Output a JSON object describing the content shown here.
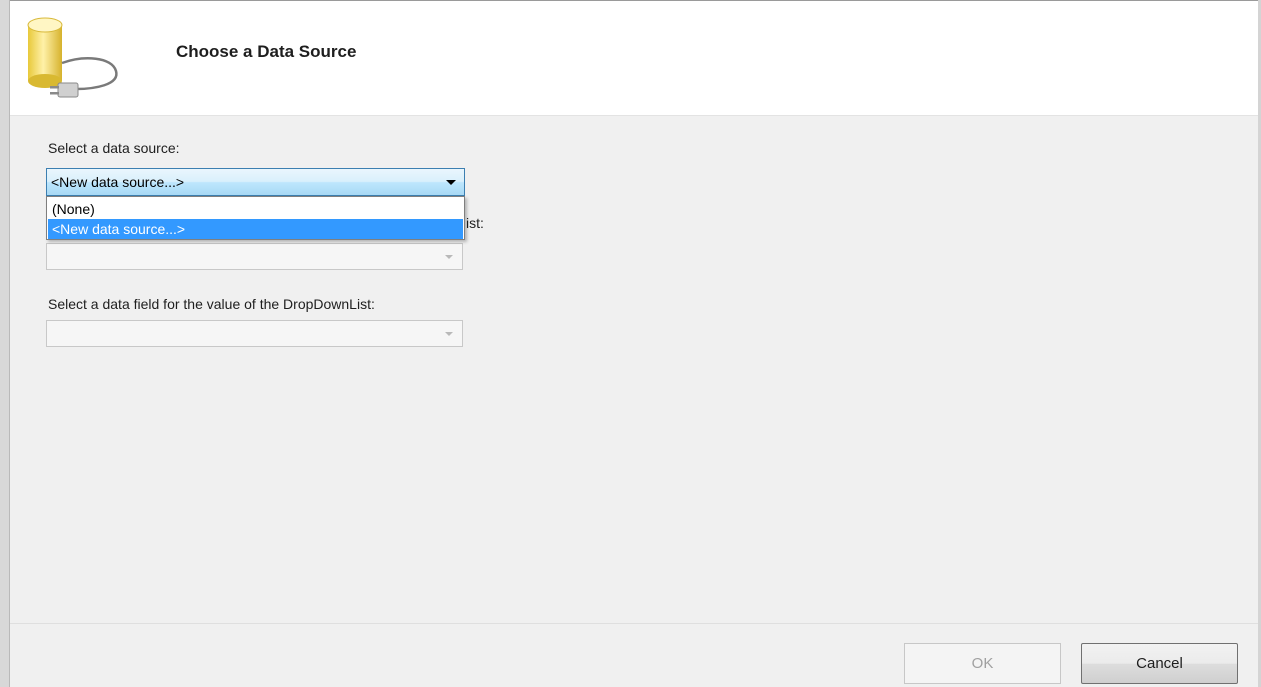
{
  "header": {
    "title": "Choose a Data Source",
    "icon": "database-plug-icon"
  },
  "data_source": {
    "label": "Select a data source:",
    "selected": "<New data source...>",
    "options": [
      "(None)",
      "<New data source...>"
    ],
    "hidden_label_suffix": "ist:"
  },
  "display_field": {
    "value": ""
  },
  "value_field": {
    "label": "Select a data field for the value of the DropDownList:",
    "value": ""
  },
  "buttons": {
    "ok": "OK",
    "cancel": "Cancel"
  },
  "colors": {
    "selection": "#3399ff",
    "dialog_background": "#f0f0f0",
    "header_background": "#ffffff"
  }
}
